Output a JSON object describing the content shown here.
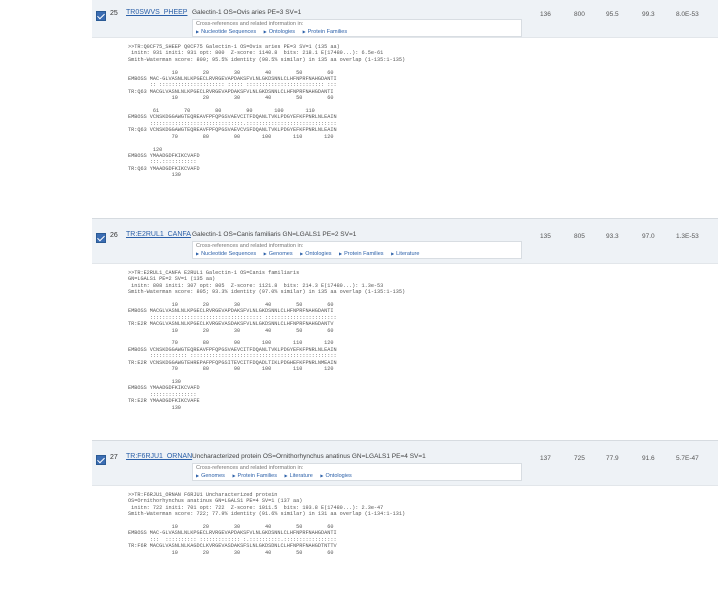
{
  "hits": [
    {
      "number": "25",
      "accession": "TR0SWVS_PHEEP",
      "description": "Galectin-1 OS=Ovis aries PE=3 SV=1",
      "xref_label": "Cross-references and related information in:",
      "xrefs": [
        "Nucleotide Sequences",
        "Ontologies",
        "Protein Families"
      ],
      "stats": [
        "136",
        "800",
        "95.5",
        "99.3",
        "8.0E-53"
      ],
      "alignment": ">>TR:Q0CF75_SHEEP Q0CF75 Galectin-1 OS=Ovis aries PE=3 SV=1 (135 aa)\n initn: 931 init1: 931 opt: 800  Z-score: 1140.8  bits: 218.1 E(17480...): 6.5e-61\nSmith-Waterman score: 800; 95.5% identity (98.5% similar) in 135 aa overlap (1-135:1-135)\n\n              10        20        30        40        50        60\nEMBOSS MAC-GLVASNLNLKPGECLRVRGEVAPDAKSFVLNLGKDSNNLCLHFNPRFNAHGDANTI\n       :: ::::::::::::::::::::: ::::: ::::::::::::::::::::::::: :::\nTR:Q63 MACGLVASNLNLKPGECLRVRGEVAPDAKSFVLNLGKDSNNLCLHFNPRFNAHGDANTI\n              10        20        30        40        50        60\n\n        61        70        80        90       100       110\nEMBOSS VCNSKDGGAWGTEQREAVFPFQPGSVAEVCITFDQANLTVKLPDGYEFKFPNRLNLEAIN\n       ::::::::::::::::::::::::::::::.:::::::::::::::::::::::::::::\nTR:Q63 VCNSKDGGAWGTEQREAVFPFQPGSVAEVCVSFDQANLTVKLPDGYEFKFPNRLNLEAIN\n              70        80        90       100       110       120\n\n        120\nEMBOSS YMAADGDFKIKCVAFD\n       :::.:::::::::::\nTR:Q63 YMAADGDFKIKCVAFD\n              130"
    },
    {
      "number": "26",
      "accession": "TR:E2RUL1_CANFA",
      "description": "Galectin-1 OS=Canis familiaris GN=LGALS1 PE=2 SV=1",
      "xref_label": "Cross-references and related information in:",
      "xrefs": [
        "Nucleotide Sequences",
        "Genomes",
        "Ontologies",
        "Protein Families",
        "Literature"
      ],
      "stats": [
        "135",
        "805",
        "93.3",
        "97.0",
        "1.3E-53"
      ],
      "alignment": ">>TR:E2RUL1_CANFA E2RUL1 Galectin-1 OS=Canis familiaris\nGN=LGALS1 PE=2 SV=1 (135 aa)\n initn: 808 init1: 307 opt: 805  Z-score: 1121.8  bits: 214.3 E(17480...): 1.3e-53\nSmith-Waterman score: 805; 93.3% identity (97.0% similar) in 135 aa overlap (1-135:1-135)\n\n              10        20        30        40        50        60\nEMBOSS MACGLVASNLNLKPGECLRVRGEVAPDAKSFVLNLGKDSNNLCLHFNPRFNAHGDANTI\n       :::::::::::::::::::::::::::::::::::: :::::::::::::::::::::::\nTR:E2R MACGLVASNLNLKPGECLKVRGEVASDAKSFVLNLGKDSNNLCLHFNPRFNAHGDANTV\n              10        20        30        40        50        60\n\n              70        80        90       100       110       120\nEMBOSS VCNSKDGGAWGTEQREAVFPFQPGSVAEVCITFDQANLTVKLPDGYEFKFPNRLNLEAIN\n       :::::::::::: :::::::::::::::::::::::::::::::::::::::::::::::\nTR:E2R VCNSKDGGAWGTEHREPAFPFQPGSITEVCITFDQADLTIKLPDGHEFKFPNRLNMEAIN\n              70        80        90       100       110       120\n\n              130\nEMBOSS YMAADGDFKIKCVAFD\n       :::::::::::::::\nTR:E2R YMAADGDFKIKCVAFE\n              130"
    },
    {
      "number": "27",
      "accession": "TR:F6RJU1_ORNAN",
      "description": "Uncharacterized protein OS=Ornithorhynchus anatinus GN=LGALS1 PE=4 SV=1",
      "xref_label": "Cross-references and related information in:",
      "xrefs": [
        "Genomes",
        "Protein Families",
        "Literature",
        "Ontologies"
      ],
      "stats": [
        "137",
        "725",
        "77.9",
        "91.6",
        "5.7E-47"
      ],
      "alignment": ">>TR:F6RJU1_ORNAN F6RJU1 Uncharacterized protein\nOS=Ornithorhynchus anatinus GN=LGALS1 PE=4 SV=1 (137 aa)\n initn: 722 init1: 701 opt: 722  Z-score: 1011.5  bits: 193.8 E(17480...): 2.3e-47\nSmith-Waterman score: 722; 77.9% identity (91.6% similar) in 131 aa overlap (1-134:1-131)\n\n              10        20        30        40        50        60\nEMBOSS MAC-GLVASNLNLKPGECLRVRGEVAPDAKSFVLNLGKDSNNLCLHFNPRFNAHGDANTI\n       :::  :::::::::: ::::::::::::: :.::::::::::.:::::::::::::::::\nTR:F6R MACGLVASNLNLKAGDCLKVRGEVASDAKSFSLNLGKDSDNLCLHFNPRFNAHGDTNTTV\n              10        20        30        40        50        60"
    }
  ]
}
